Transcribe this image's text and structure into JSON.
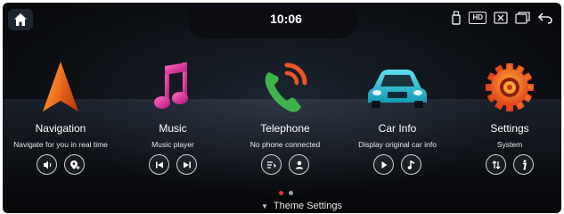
{
  "status": {
    "time": "10:06",
    "hd_label": "HD"
  },
  "apps": [
    {
      "title": "Navigation",
      "subtitle": "Navigate for you in real time"
    },
    {
      "title": "Music",
      "subtitle": "Music player"
    },
    {
      "title": "Telephone",
      "subtitle": "No phone connected"
    },
    {
      "title": "Car Info",
      "subtitle": "Display original car info"
    },
    {
      "title": "Settings",
      "subtitle": "System"
    }
  ],
  "page_indicator": {
    "total": 2,
    "active": 0
  },
  "theme": {
    "label": "Theme Settings"
  },
  "colors": {
    "active_dot": "#e0302a",
    "inactive_dot": "#9aa0a8"
  }
}
